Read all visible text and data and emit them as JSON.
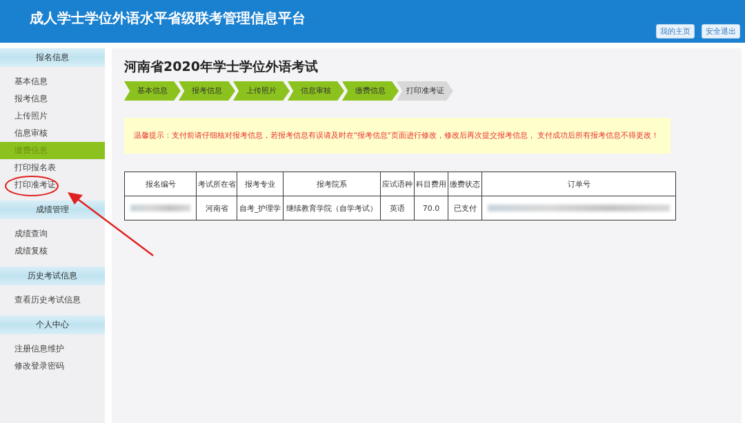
{
  "header": {
    "title": "成人学士学位外语水平省级联考管理信息平台",
    "buttons": [
      "我的主页",
      "安全退出"
    ]
  },
  "sidebar": {
    "sections": [
      {
        "title": "报名信息",
        "items": [
          {
            "label": "基本信息",
            "selected": false
          },
          {
            "label": "报考信息",
            "selected": false
          },
          {
            "label": "上传照片",
            "selected": false
          },
          {
            "label": "信息审核",
            "selected": false
          },
          {
            "label": "缴费信息",
            "selected": true
          },
          {
            "label": "打印报名表",
            "selected": false
          },
          {
            "label": "打印准考证",
            "selected": false,
            "annotated": true
          }
        ]
      },
      {
        "title": "成绩管理",
        "items": [
          {
            "label": "成绩查询",
            "selected": false
          },
          {
            "label": "成绩复核",
            "selected": false
          }
        ]
      },
      {
        "title": "历史考试信息",
        "items": [
          {
            "label": "查看历史考试信息",
            "selected": false
          }
        ]
      },
      {
        "title": "个人中心",
        "items": [
          {
            "label": "注册信息维护",
            "selected": false
          },
          {
            "label": "修改登录密码",
            "selected": false
          }
        ]
      }
    ]
  },
  "main": {
    "title": "河南省2020年学士学位外语考试",
    "steps": [
      {
        "label": "基本信息",
        "done": true
      },
      {
        "label": "报考信息",
        "done": true
      },
      {
        "label": "上传照片",
        "done": true
      },
      {
        "label": "信息审核",
        "done": true
      },
      {
        "label": "缴费信息",
        "done": true
      },
      {
        "label": "打印准考证",
        "done": false
      }
    ],
    "notice": "温馨提示：支付前请仔细核对报考信息，若报考信息有误请及时在\"报考信息\"页面进行修改，修改后再次提交报考信息， 支付成功后所有报考信息不得更改！",
    "table": {
      "columns": [
        "报名编号",
        "考试所在省",
        "报考专业",
        "报考院系",
        "应试语种",
        "科目费用",
        "缴费状态",
        "订单号"
      ],
      "rows": [
        [
          {
            "kind": "blurred"
          },
          {
            "kind": "text",
            "text": "河南省"
          },
          {
            "kind": "text",
            "text": "自考_护理学"
          },
          {
            "kind": "text",
            "text": "继续教育学院（自学考试）"
          },
          {
            "kind": "text",
            "text": "英语"
          },
          {
            "kind": "text",
            "text": "70.0"
          },
          {
            "kind": "text",
            "text": "已支付"
          },
          {
            "kind": "blurred"
          }
        ]
      ]
    }
  }
}
